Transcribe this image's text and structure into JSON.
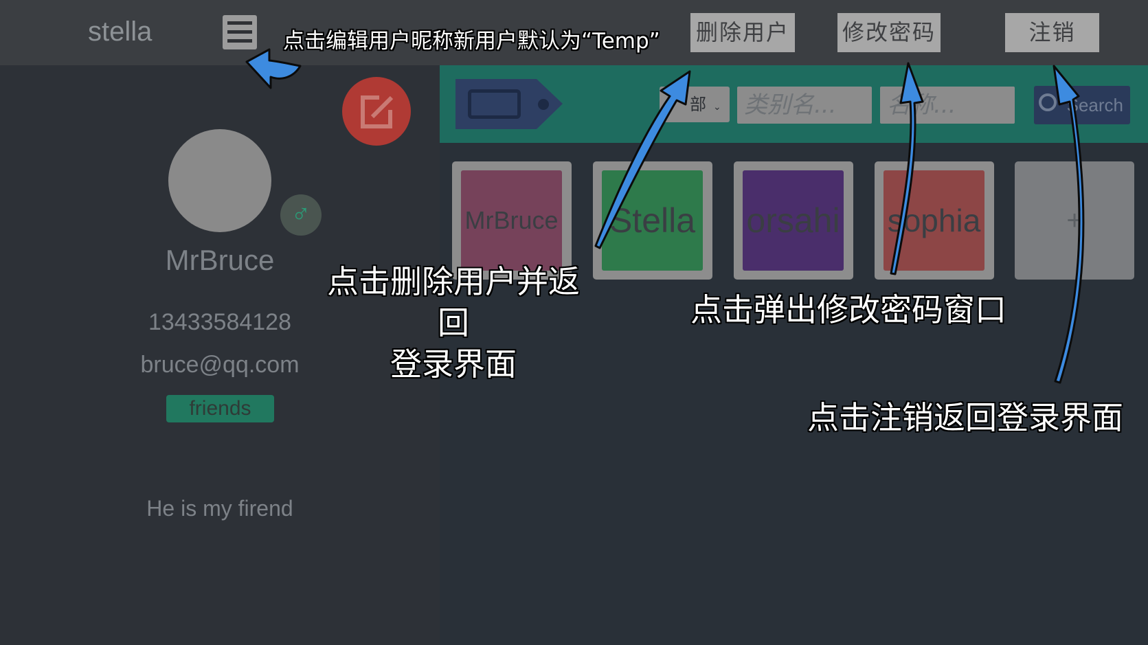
{
  "header": {
    "app_title": "stella",
    "menu_icon": "hamburger-menu-icon",
    "buttons": {
      "delete_user": "删除用户",
      "change_password": "修改密码",
      "logout": "注销"
    }
  },
  "profile": {
    "name": "MrBruce",
    "phone": "13433584128",
    "email": "bruce@qq.com",
    "tag": "friends",
    "bio": "He is my firend",
    "gender_icon": "male-icon"
  },
  "filter": {
    "select_value": "部",
    "category_placeholder": "类别名...",
    "name_placeholder": "名称...",
    "search_label": "Search"
  },
  "cards": [
    {
      "label": "MrBruce",
      "color": "#76425a"
    },
    {
      "label": "Stella",
      "color": "#2e7a4b"
    },
    {
      "label": "orsahi",
      "color": "#4a2e6b"
    },
    {
      "label": "sophia",
      "color": "#8d4646"
    }
  ],
  "add_card_label": "+",
  "annotations": {
    "edit_nickname": "点击编辑用户昵称新用户默认为“Temp”",
    "delete_line1": "点击删除用户并返回",
    "delete_line2": "登录界面",
    "change_pwd": "点击弹出修改密码窗口",
    "logout": "点击注销返回登录界面"
  },
  "colors": {
    "overlay_arrow": "#3d8be0",
    "edit_button": "#b03a34",
    "filter_bar": "#1e6c5f",
    "tag": "#21785f"
  }
}
